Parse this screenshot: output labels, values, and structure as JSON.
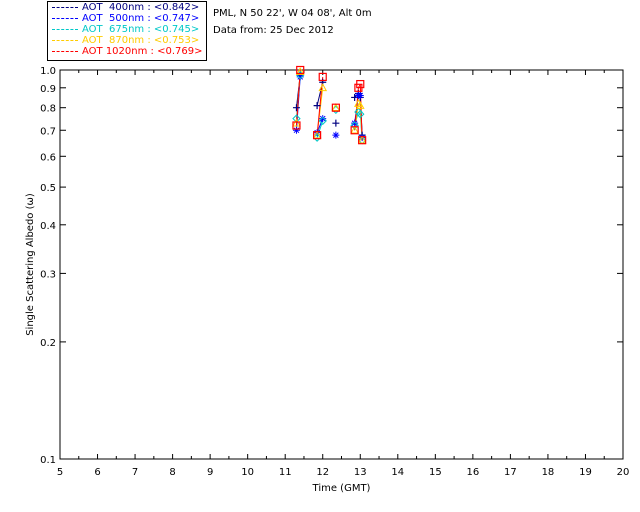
{
  "header": {
    "site": "PML, N 50 22', W 04 08', Alt 0m",
    "date": "Data from: 25 Dec 2012"
  },
  "chart_data": {
    "type": "scatter",
    "xlabel": "Time (GMT)",
    "ylabel": "Single Scattering Albedo (ω)",
    "xlim": [
      5,
      20
    ],
    "ylim": [
      0.1,
      1.0
    ],
    "yscale": "log",
    "x_ticks": [
      "5",
      "6",
      "7",
      "8",
      "9",
      "10",
      "11",
      "12",
      "13",
      "14",
      "15",
      "16",
      "17",
      "18",
      "19",
      "20"
    ],
    "y_ticks": [
      "0.1",
      "0.2",
      "0.3",
      "0.4",
      "0.5",
      "0.6",
      "0.7",
      "0.8",
      "0.9",
      "1.0"
    ],
    "grid": false,
    "legend_placement": "top-left outside",
    "series": [
      {
        "name": "AOT  400nm : <0.842>",
        "color": "#000080",
        "marker": "plus",
        "x": [
          11.3,
          11.4,
          11.85,
          12.0,
          12.35,
          12.85,
          12.95,
          13.0,
          13.05
        ],
        "y": [
          0.8,
          0.97,
          0.81,
          0.93,
          0.73,
          0.85,
          0.87,
          0.85,
          0.68
        ]
      },
      {
        "name": "AOT  500nm : <0.747>",
        "color": "#0000ff",
        "marker": "asterisk",
        "x": [
          11.3,
          11.4,
          11.85,
          12.0,
          12.35,
          12.85,
          12.95,
          13.0,
          13.05
        ],
        "y": [
          0.7,
          0.96,
          0.69,
          0.75,
          0.68,
          0.73,
          0.86,
          0.86,
          0.67
        ]
      },
      {
        "name": "AOT  675nm : <0.745>",
        "color": "#00c8c8",
        "marker": "diamond",
        "x": [
          11.3,
          11.4,
          11.85,
          12.0,
          12.35,
          12.85,
          12.95,
          13.0,
          13.05
        ],
        "y": [
          0.75,
          0.97,
          0.67,
          0.74,
          0.79,
          0.72,
          0.78,
          0.77,
          0.66
        ]
      },
      {
        "name": "AOT  870nm : <0.753>",
        "color": "#ffcc00",
        "marker": "triangle",
        "x": [
          11.3,
          11.4,
          11.85,
          12.0,
          12.35,
          12.85,
          12.95,
          13.0,
          13.05
        ],
        "y": [
          0.73,
          0.99,
          0.68,
          0.9,
          0.8,
          0.7,
          0.82,
          0.81,
          0.66
        ]
      },
      {
        "name": "AOT 1020nm : <0.769>",
        "color": "#ff0000",
        "marker": "square",
        "x": [
          11.3,
          11.4,
          11.85,
          12.0,
          12.35,
          12.85,
          12.95,
          13.0,
          13.05
        ],
        "y": [
          0.72,
          1.0,
          0.68,
          0.96,
          0.8,
          0.7,
          0.9,
          0.92,
          0.66
        ]
      }
    ]
  }
}
